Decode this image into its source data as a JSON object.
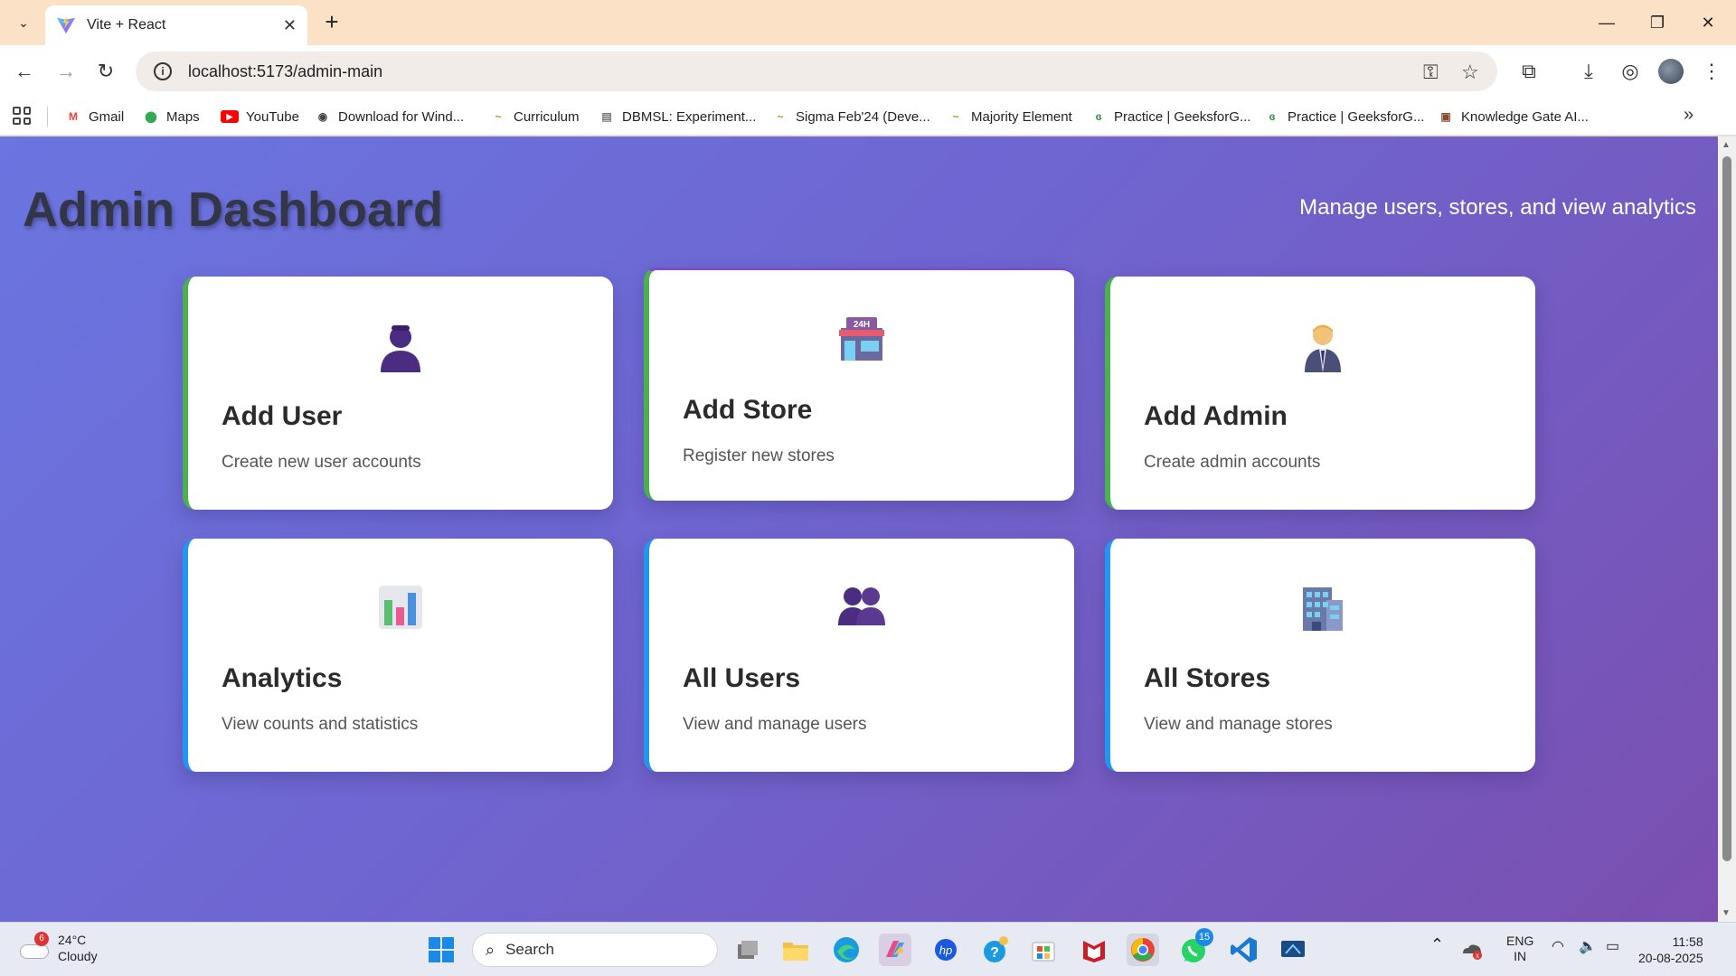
{
  "browser": {
    "tab_title": "Vite + React",
    "url": "localhost:5173/admin-main",
    "bookmarks": [
      {
        "label": "Gmail",
        "color": "#ea4335",
        "glyph": "M"
      },
      {
        "label": "Maps",
        "color": "#34a853",
        "glyph": "⬤"
      },
      {
        "label": "YouTube",
        "color": "#ff0000",
        "glyph": "▶"
      },
      {
        "label": "Download for Wind...",
        "color": "#555555",
        "glyph": "◉"
      },
      {
        "label": "Curriculum",
        "color": "#b88a2a",
        "glyph": "~"
      },
      {
        "label": "DBMSL: Experiment...",
        "color": "#777777",
        "glyph": "▤"
      },
      {
        "label": "Sigma Feb'24 (Deve...",
        "color": "#b88a2a",
        "glyph": "~"
      },
      {
        "label": "Majority Element",
        "color": "#b88a2a",
        "glyph": "~"
      },
      {
        "label": "Practice | GeeksforG...",
        "color": "#2f8d46",
        "glyph": "ɞ"
      },
      {
        "label": "Practice | GeeksforG...",
        "color": "#2f8d46",
        "glyph": "ɞ"
      },
      {
        "label": "Knowledge Gate AI...",
        "color": "#8a4a2a",
        "glyph": "▣"
      }
    ]
  },
  "page": {
    "title": "Admin Dashboard",
    "subtitle": "Manage users, stores, and view analytics",
    "cards": [
      {
        "title": "Add User",
        "desc": "Create new user accounts",
        "icon": "👤"
      },
      {
        "title": "Add Store",
        "desc": "Register new stores",
        "icon": "🏪"
      },
      {
        "title": "Add Admin",
        "desc": "Create admin accounts",
        "icon": "👨‍💼"
      },
      {
        "title": "Analytics",
        "desc": "View counts and statistics",
        "icon": "📊"
      },
      {
        "title": "All Users",
        "desc": "View and manage users",
        "icon": "👥"
      },
      {
        "title": "All Stores",
        "desc": "View and manage stores",
        "icon": "🏢"
      }
    ]
  },
  "taskbar": {
    "weather_temp": "24°C",
    "weather_desc": "Cloudy",
    "weather_badge": "6",
    "search_label": "Search",
    "whatsapp_badge": "15",
    "lang_top": "ENG",
    "lang_bottom": "IN",
    "time": "11:58",
    "date": "20-08-2025"
  }
}
